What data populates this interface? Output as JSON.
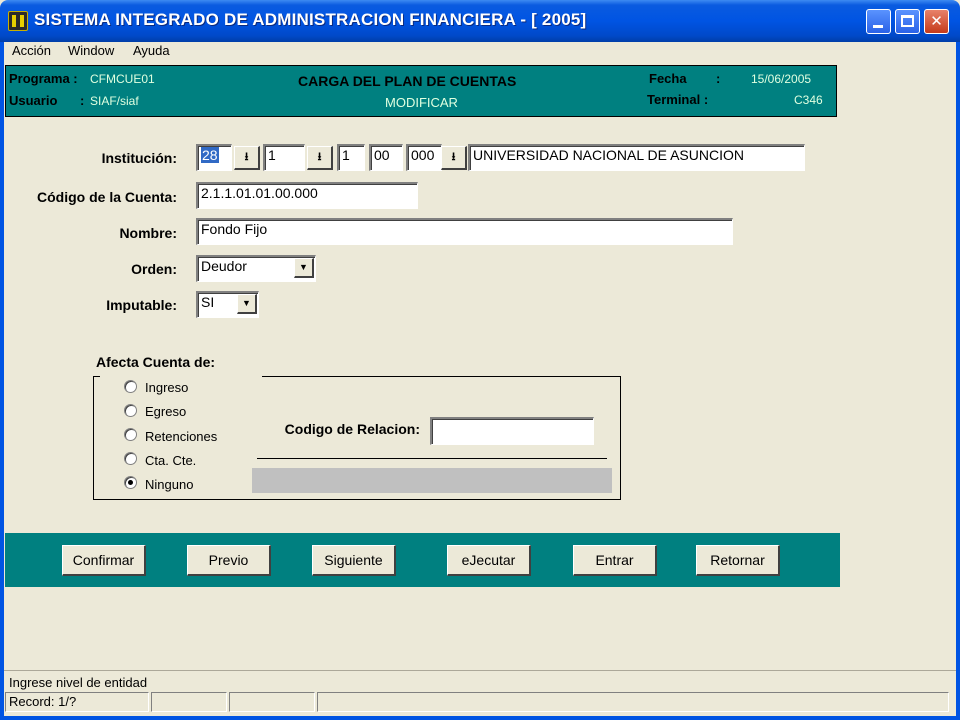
{
  "window": {
    "title": "SISTEMA INTEGRADO DE ADMINISTRACION FINANCIERA - [ 2005]",
    "controls": {
      "minimize": "_",
      "maximize": "□",
      "close": "✕"
    }
  },
  "menu": {
    "items": [
      {
        "label": "Acción"
      },
      {
        "label": "Window"
      },
      {
        "label": "Ayuda"
      }
    ]
  },
  "header": {
    "programa_label": "Programa :",
    "programa_value": "CFMCUE01",
    "usuario_label": "Usuario",
    "usuario_sep": ":",
    "usuario_value": "SIAF/siaf",
    "title": "CARGA DEL PLAN DE CUENTAS",
    "mode": "MODIFICAR",
    "fecha_label": "Fecha",
    "fecha_sep": ":",
    "fecha_value": "15/06/2005",
    "terminal_label": "Terminal :",
    "terminal_value": "C346"
  },
  "form": {
    "institucion_label": "Institución:",
    "institucion_values": [
      "28",
      "1",
      "1",
      "00",
      "000"
    ],
    "institucion_name": "UNIVERSIDAD NACIONAL DE ASUNCION",
    "codigo_label": "Código de la Cuenta:",
    "codigo_value": "2.1.1.01.01.00.000",
    "nombre_label": "Nombre:",
    "nombre_value": "Fondo Fijo",
    "orden_label": "Orden:",
    "orden_value": "Deudor",
    "imputable_label": "Imputable:",
    "imputable_value": "SI"
  },
  "afecta": {
    "group_label": "Afecta Cuenta de:",
    "options": [
      {
        "label": "Ingreso",
        "selected": false
      },
      {
        "label": "Egreso",
        "selected": false
      },
      {
        "label": "Retenciones",
        "selected": false
      },
      {
        "label": "Cta. Cte.",
        "selected": false
      },
      {
        "label": "Ninguno",
        "selected": true
      }
    ],
    "relacion_label": "Codigo de Relacion:",
    "relacion_value": ""
  },
  "buttons": [
    {
      "label": "Confirmar"
    },
    {
      "label": "Previo"
    },
    {
      "label": "Siguiente"
    },
    {
      "label": "eJecutar"
    },
    {
      "label": "Entrar"
    },
    {
      "label": "Retornar"
    }
  ],
  "status": {
    "message": "Ingrese nivel de entidad",
    "record": "Record: 1/?"
  },
  "colors": {
    "title_bar": "#0054e3",
    "teal": "#008080",
    "window_bg": "#ece9d8"
  }
}
